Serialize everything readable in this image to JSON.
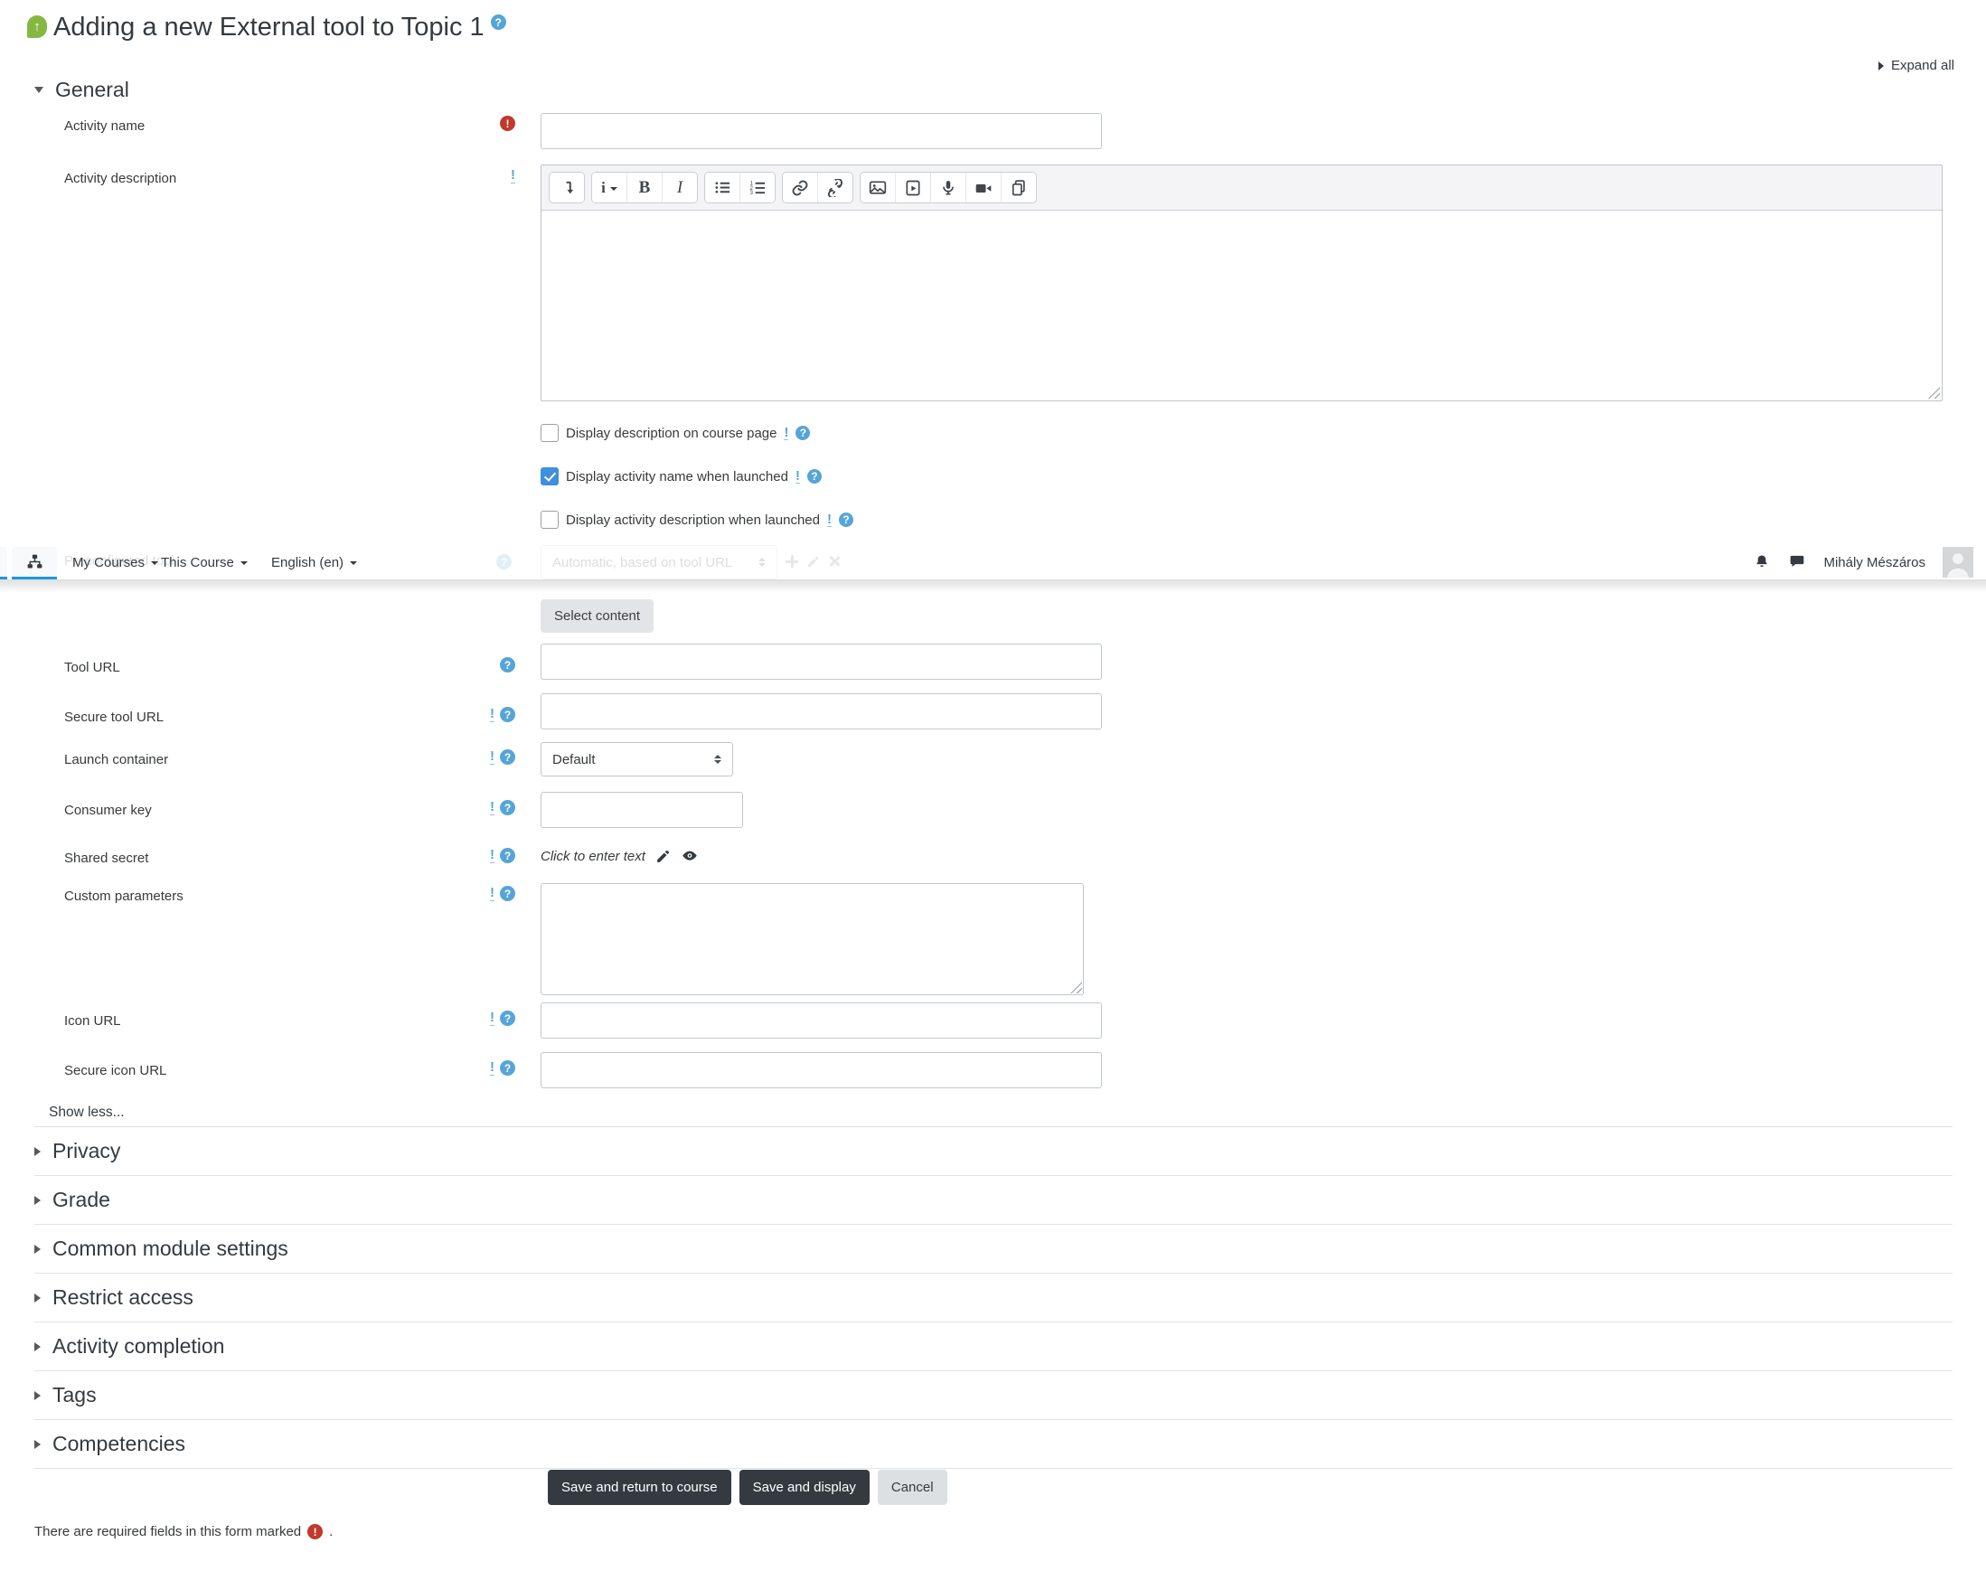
{
  "page": {
    "title": "Adding a new External tool to Topic 1",
    "expand_all": "Expand all",
    "footer_required_note": "There are required fields in this form marked",
    "footer_required_suffix": "."
  },
  "navbar": {
    "menu": [
      {
        "label": "My Courses"
      },
      {
        "label": "This Course"
      },
      {
        "label": "English (en)"
      }
    ],
    "user_name": "Mihály Mészáros"
  },
  "form": {
    "general_heading": "General",
    "activity_name": {
      "label": "Activity name",
      "value": "",
      "required": true
    },
    "activity_description": {
      "label": "Activity description",
      "value": ""
    },
    "checkboxes": [
      {
        "label": "Display description on course page",
        "checked": false
      },
      {
        "label": "Display activity name when launched",
        "checked": true
      },
      {
        "label": "Display activity description when launched",
        "checked": false
      }
    ],
    "preconfigured_tool": {
      "label": "Preconfigured tool",
      "value": "Automatic, based on tool URL"
    },
    "select_content_button": "Select content",
    "tool_url": {
      "label": "Tool URL",
      "value": ""
    },
    "secure_tool_url": {
      "label": "Secure tool URL",
      "value": ""
    },
    "launch_container": {
      "label": "Launch container",
      "value": "Default"
    },
    "consumer_key": {
      "label": "Consumer key",
      "value": ""
    },
    "shared_secret": {
      "label": "Shared secret",
      "value": "Click to enter text"
    },
    "custom_parameters": {
      "label": "Custom parameters",
      "value": ""
    },
    "icon_url": {
      "label": "Icon URL",
      "value": ""
    },
    "secure_icon_url": {
      "label": "Secure icon URL",
      "value": ""
    },
    "show_less": "Show less...",
    "collapsed_sections": [
      {
        "label": "Privacy"
      },
      {
        "label": "Grade"
      },
      {
        "label": "Common module settings"
      },
      {
        "label": "Restrict access"
      },
      {
        "label": "Activity completion"
      },
      {
        "label": "Tags"
      },
      {
        "label": "Competencies"
      }
    ],
    "buttons": {
      "save_return": "Save and return to course",
      "save_display": "Save and display",
      "cancel": "Cancel"
    }
  },
  "editor": {
    "toolbar_icons": [
      "toolbar-toggle",
      "paragraph-styles",
      "bold",
      "italic",
      "unordered-list",
      "ordered-list",
      "link",
      "unlink",
      "insert-image",
      "insert-media",
      "record-audio",
      "record-video",
      "manage-files"
    ]
  },
  "icons": {
    "help_glyph": "?",
    "required_glyph": "!",
    "warning_glyph": "!",
    "up_arrow_glyph": "↑",
    "bold_glyph": "B",
    "italic_glyph": "I",
    "styles_glyph": "i"
  },
  "colors": {
    "accent_blue": "#1b96e3",
    "help_blue": "#56a5d8",
    "required_red": "#c0392b",
    "checkbox_blue": "#3e8fde",
    "button_dark": "#343a40",
    "tool_icon_green": "#84b841"
  }
}
